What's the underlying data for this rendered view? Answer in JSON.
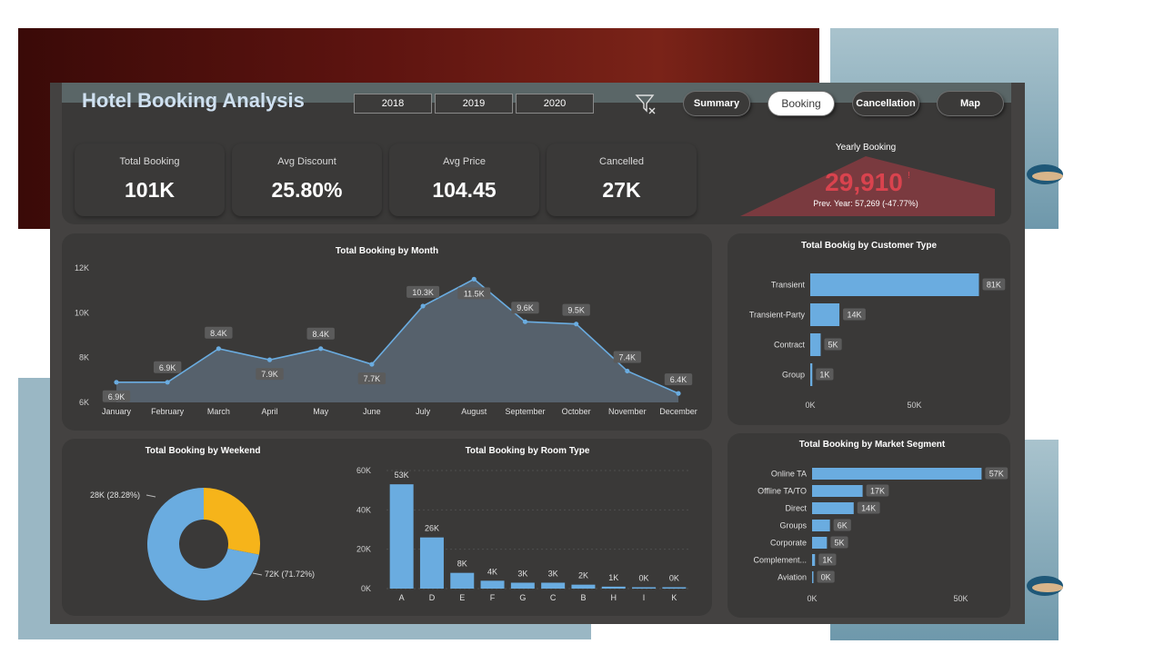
{
  "header": {
    "title": "Hotel Booking Analysis",
    "years": [
      "2018",
      "2019",
      "2020"
    ],
    "nav": [
      {
        "label": "Summary",
        "active": false
      },
      {
        "label": "Booking",
        "active": true
      },
      {
        "label": "Cancellation",
        "active": false
      },
      {
        "label": "Map",
        "active": false
      }
    ],
    "filter_icon": "clear-filter-icon"
  },
  "kpis": [
    {
      "label": "Total Booking",
      "value": "101K"
    },
    {
      "label": "Avg Discount",
      "value": "25.80%"
    },
    {
      "label": "Avg Price",
      "value": "104.45"
    },
    {
      "label": "Cancelled",
      "value": "27K"
    }
  ],
  "yearly": {
    "title": "Yearly Booking",
    "value": "29,910",
    "marker": "!",
    "prev": "Prev. Year: 57,269 (-47.77%)",
    "color": "#d9434e"
  },
  "colors": {
    "blue": "#6aace0",
    "yellow": "#f6b41a",
    "panel": "#3a3938",
    "dash": "#444241"
  },
  "chart_data": [
    {
      "type": "area",
      "title": "Total Booking by Month",
      "categories": [
        "January",
        "February",
        "March",
        "April",
        "May",
        "June",
        "July",
        "August",
        "September",
        "October",
        "November",
        "December"
      ],
      "values": [
        6.9,
        6.9,
        8.4,
        7.9,
        8.4,
        7.7,
        10.3,
        11.5,
        9.6,
        9.5,
        7.4,
        6.4
      ],
      "data_labels": [
        "6.9K",
        "6.9K",
        "8.4K",
        "7.9K",
        "8.4K",
        "7.7K",
        "10.3K",
        "11.5K",
        "9.6K",
        "9.5K",
        "7.4K",
        "6.4K"
      ],
      "y_ticks": [
        "12K",
        "10K",
        "8K",
        "6K"
      ],
      "ylim": [
        6,
        12
      ]
    },
    {
      "type": "bar",
      "orientation": "horizontal",
      "title": "Total Bookig by Customer Type",
      "categories": [
        "Transient",
        "Transient-Party",
        "Contract",
        "Group"
      ],
      "values": [
        81,
        14,
        5,
        1
      ],
      "data_labels": [
        "81K",
        "14K",
        "5K",
        "1K"
      ],
      "x_ticks": [
        "0K",
        "50K"
      ],
      "xlim": [
        0,
        100
      ]
    },
    {
      "type": "pie",
      "title": "Total Booking by Weekend",
      "values": [
        28,
        72
      ],
      "data_labels": [
        "28K (28.28%)",
        "72K (71.72%)"
      ],
      "colors": [
        "#f6b41a",
        "#6aace0"
      ]
    },
    {
      "type": "bar",
      "title": "Total Booking by Room Type",
      "categories": [
        "A",
        "D",
        "E",
        "F",
        "G",
        "C",
        "B",
        "H",
        "I",
        "K"
      ],
      "values": [
        53,
        26,
        8,
        4,
        3,
        3,
        2,
        1,
        0,
        0
      ],
      "data_labels": [
        "53K",
        "26K",
        "8K",
        "4K",
        "3K",
        "3K",
        "2K",
        "1K",
        "0K",
        "0K"
      ],
      "y_ticks": [
        "60K",
        "40K",
        "20K",
        "0K"
      ],
      "ylim": [
        0,
        60
      ]
    },
    {
      "type": "bar",
      "orientation": "horizontal",
      "title": "Total Booking by Market Segment",
      "categories": [
        "Online TA",
        "Offline TA/TO",
        "Direct",
        "Groups",
        "Corporate",
        "Complement...",
        "Aviation"
      ],
      "values": [
        57,
        17,
        14,
        6,
        5,
        1,
        0
      ],
      "data_labels": [
        "57K",
        "17K",
        "14K",
        "6K",
        "5K",
        "1K",
        "0K"
      ],
      "x_ticks": [
        "0K",
        "50K"
      ],
      "xlim": [
        0,
        100
      ]
    }
  ]
}
